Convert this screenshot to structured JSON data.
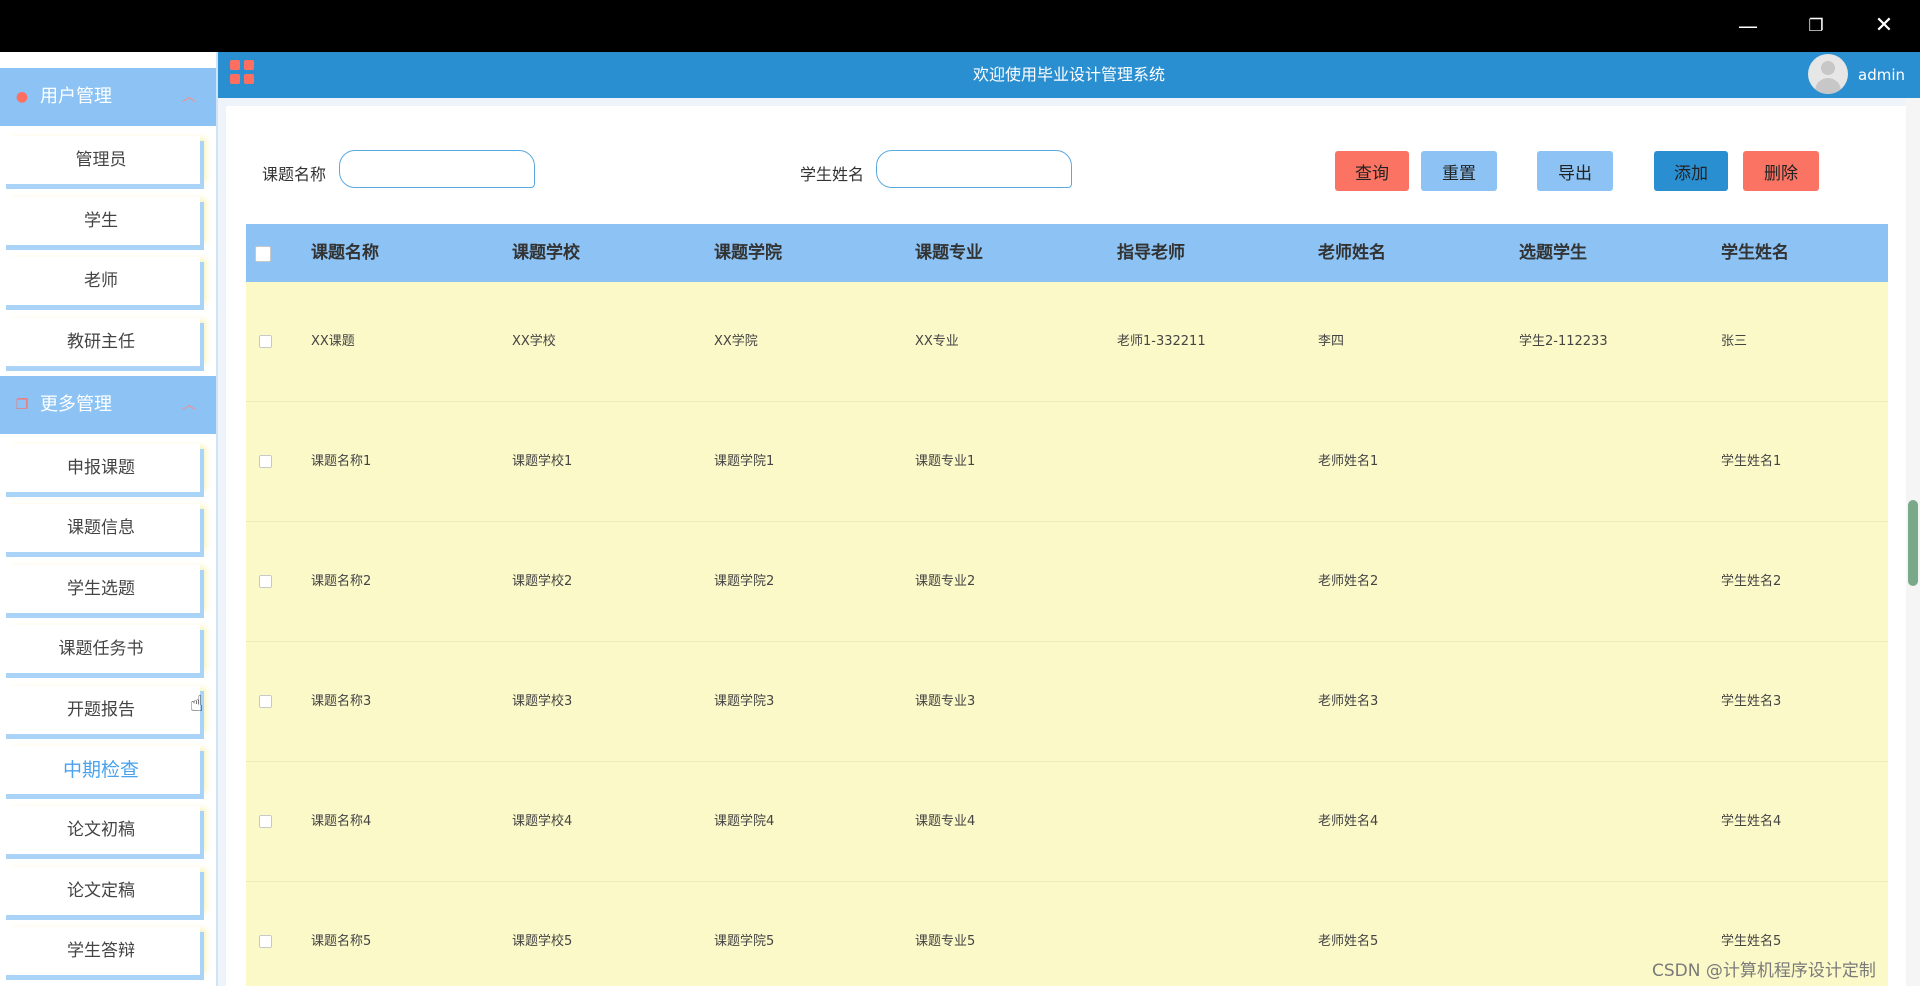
{
  "window": {
    "min_icon": "—",
    "max_icon": "❐",
    "close_icon": "✕"
  },
  "header": {
    "title": "欢迎使用毕业设计管理系统",
    "user": "admin"
  },
  "sidebar": {
    "groups": [
      {
        "label": "用户管理",
        "icon": "user-icon",
        "items": [
          "管理员",
          "学生",
          "老师",
          "教研主任"
        ]
      },
      {
        "label": "更多管理",
        "icon": "copy-icon",
        "items": [
          "申报课题",
          "课题信息",
          "学生选题",
          "课题任务书",
          "开题报告",
          "中期检查",
          "论文初稿",
          "论文定稿",
          "学生答辩"
        ]
      }
    ],
    "active_item": "中期检查"
  },
  "search": {
    "topic_label": "课题名称",
    "topic_value": "",
    "student_label": "学生姓名",
    "student_value": ""
  },
  "buttons": {
    "query": "查询",
    "reset": "重置",
    "export": "导出",
    "add": "添加",
    "delete": "删除"
  },
  "table": {
    "columns": [
      "课题名称",
      "课题学校",
      "课题学院",
      "课题专业",
      "指导老师",
      "老师姓名",
      "选题学生",
      "学生姓名"
    ],
    "rows": [
      [
        "XX课题",
        "XX学校",
        "XX学院",
        "XX专业",
        "老师1-332211",
        "李四",
        "学生2-112233",
        "张三"
      ],
      [
        "课题名称1",
        "课题学校1",
        "课题学院1",
        "课题专业1",
        "",
        "老师姓名1",
        "",
        "学生姓名1"
      ],
      [
        "课题名称2",
        "课题学校2",
        "课题学院2",
        "课题专业2",
        "",
        "老师姓名2",
        "",
        "学生姓名2"
      ],
      [
        "课题名称3",
        "课题学校3",
        "课题学院3",
        "课题专业3",
        "",
        "老师姓名3",
        "",
        "学生姓名3"
      ],
      [
        "课题名称4",
        "课题学校4",
        "课题学院4",
        "课题专业4",
        "",
        "老师姓名4",
        "",
        "学生姓名4"
      ],
      [
        "课题名称5",
        "课题学校5",
        "课题学院5",
        "课题专业5",
        "",
        "老师姓名5",
        "",
        "学生姓名5"
      ]
    ]
  },
  "watermark": "CSDN @计算机程序设计定制",
  "colors": {
    "header": "#2a8fd1",
    "sidebar_group": "#8cc3f4",
    "row_bg": "#fbf9c8",
    "danger": "#fb7463"
  }
}
